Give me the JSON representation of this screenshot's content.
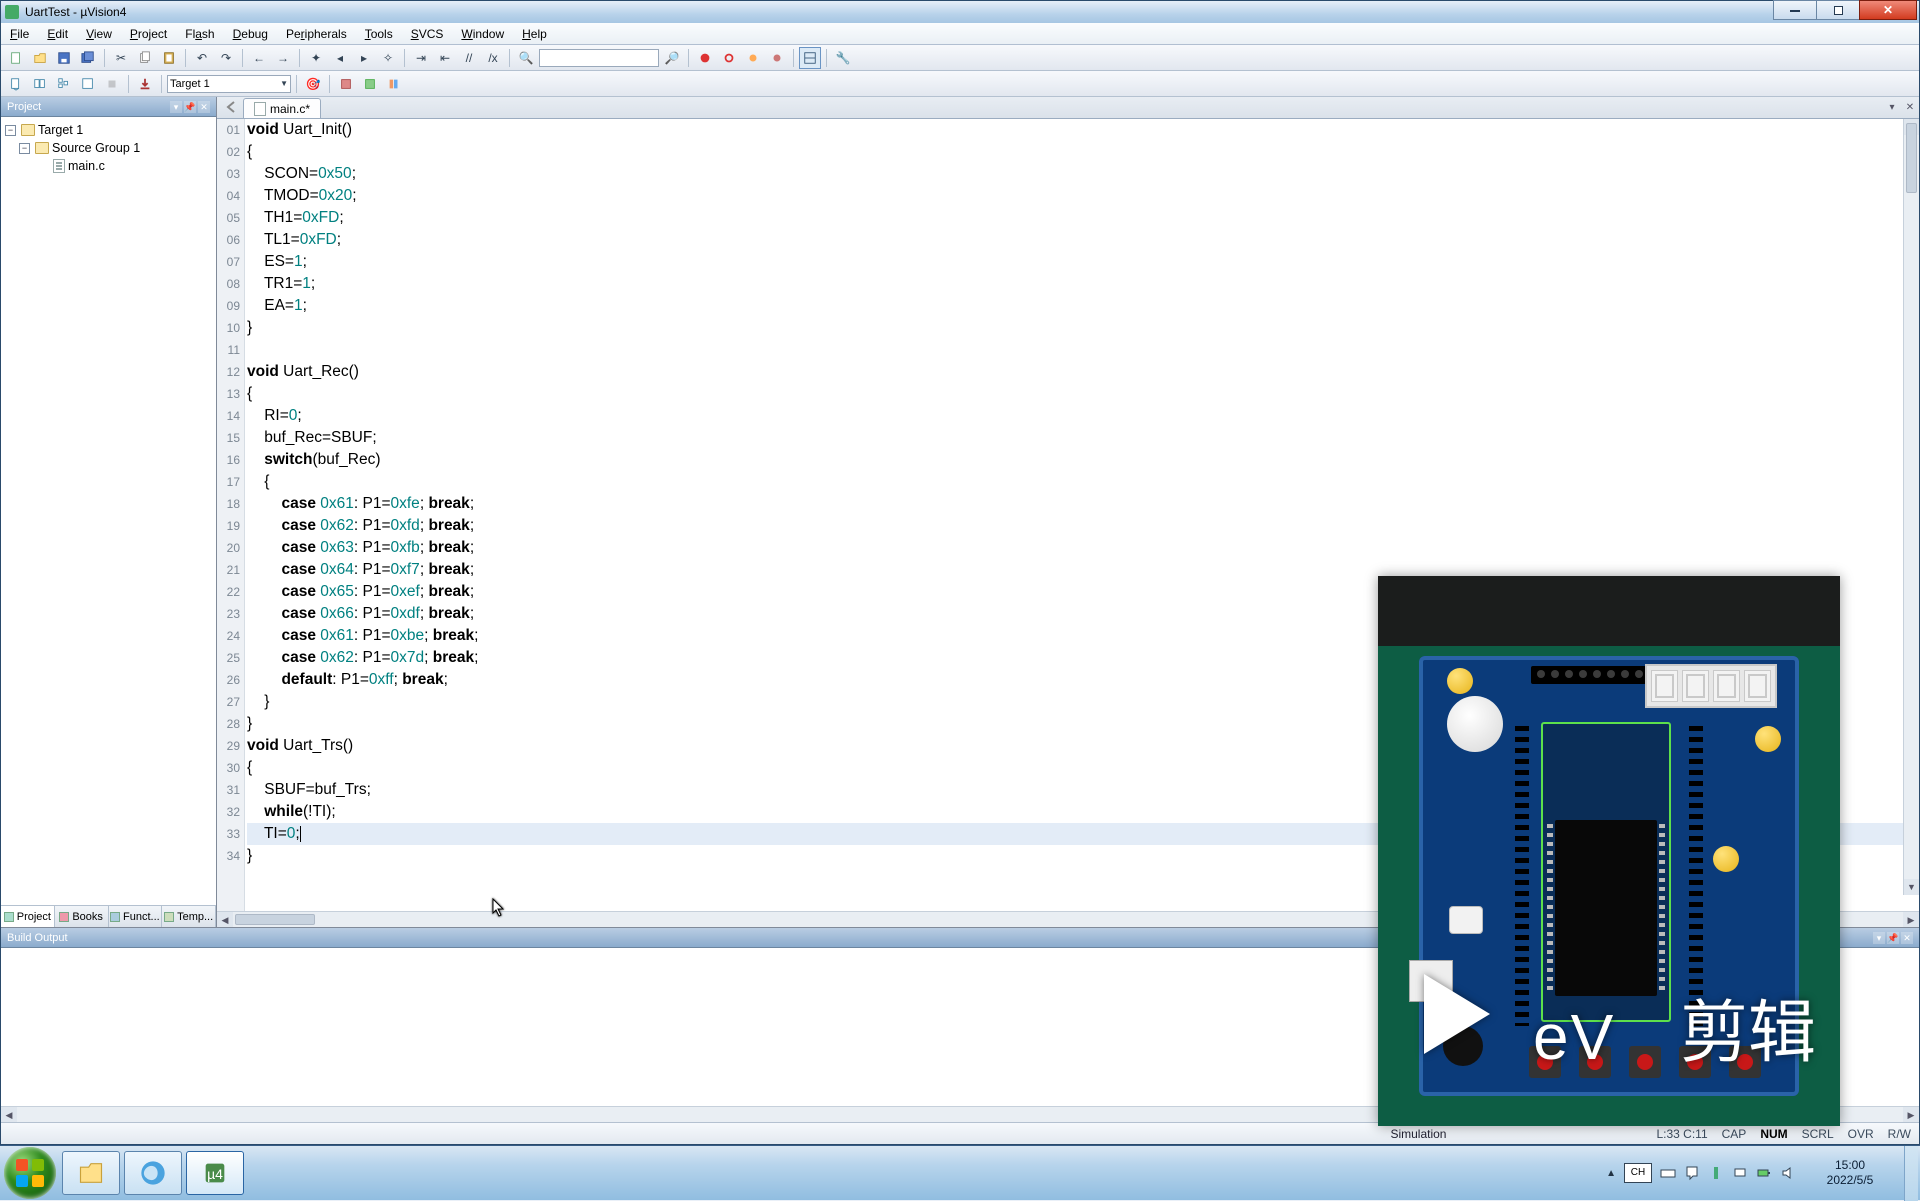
{
  "window": {
    "title": "UartTest  -  µVision4"
  },
  "menu": {
    "file": "File",
    "edit": "Edit",
    "view": "View",
    "project": "Project",
    "flash": "Flash",
    "debug": "Debug",
    "peripherals": "Peripherals",
    "tools": "Tools",
    "svcs": "SVCS",
    "window": "Window",
    "help": "Help"
  },
  "toolbar2": {
    "target": "Target 1"
  },
  "projectPane": {
    "title": "Project",
    "root": "Target 1",
    "group": "Source Group 1",
    "file": "main.c",
    "tabs": {
      "project": "Project",
      "books": "Books",
      "func": "Funct...",
      "temp": "Temp..."
    }
  },
  "editor": {
    "tab": "main.c*",
    "lines": [
      "void Uart_Init()",
      "{",
      "    SCON=0x50;",
      "    TMOD=0x20;",
      "    TH1=0xFD;",
      "    TL1=0xFD;",
      "    ES=1;",
      "    TR1=1;",
      "    EA=1;",
      "}",
      "",
      "void Uart_Rec()",
      "{",
      "    RI=0;",
      "    buf_Rec=SBUF;",
      "    switch(buf_Rec)",
      "    {",
      "        case 0x61: P1=0xfe; break;",
      "        case 0x62: P1=0xfd; break;",
      "        case 0x63: P1=0xfb; break;",
      "        case 0x64: P1=0xf7; break;",
      "        case 0x65: P1=0xef; break;",
      "        case 0x66: P1=0xdf; break;",
      "        case 0x61: P1=0xbe; break;",
      "        case 0x62: P1=0x7d; break;",
      "        default: P1=0xff; break;",
      "    }",
      "}",
      "void Uart_Trs()",
      "{",
      "    SBUF=buf_Trs;",
      "    while(!TI);",
      "    TI=0;",
      "}"
    ],
    "first_line_no": 1,
    "cursor_line": 33
  },
  "buildOutput": {
    "title": "Build Output"
  },
  "status": {
    "mode": "Simulation",
    "pos": "L:33 C:11",
    "ind": {
      "cap": "CAP",
      "num": "NUM",
      "scrl": "SCRL",
      "ovr": "OVR",
      "rw": "R/W"
    }
  },
  "tray": {
    "ime": "CH",
    "time": "15:00",
    "date": "2022/5/5"
  },
  "overlay": {
    "ev_text": "eV",
    "cn_text": "剪辑"
  }
}
